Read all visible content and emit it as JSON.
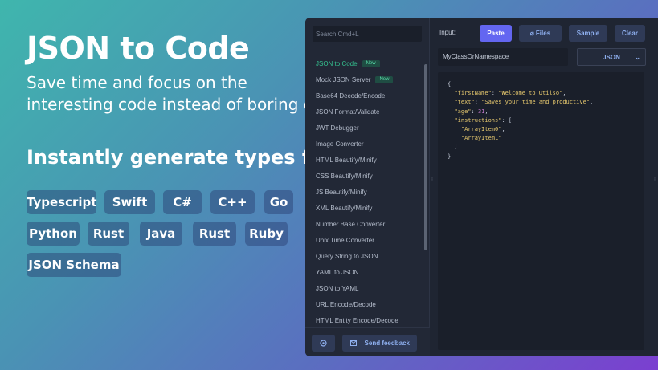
{
  "hero": {
    "title": "JSON to Code",
    "subtitle_line1": "Save time and focus on the",
    "subtitle_line2": "interesting code instead of boring one",
    "types_title": "Instantly generate types for",
    "languages": [
      "Typescript",
      "Swift",
      "C#",
      "C++",
      "Go",
      "Python",
      "Rust",
      "Java",
      "Rust",
      "Ruby",
      "JSON Schema"
    ]
  },
  "sidebar": {
    "search_placeholder": "Search Cmd+L",
    "items": [
      {
        "label": "JSON to Code",
        "badge": "New",
        "active": true
      },
      {
        "label": "Mock JSON Server",
        "badge": "New"
      },
      {
        "label": "Base64 Decode/Encode"
      },
      {
        "label": "JSON Format/Validate"
      },
      {
        "label": "JWT Debugger"
      },
      {
        "label": "Image Converter"
      },
      {
        "label": "HTML Beautify/Minify"
      },
      {
        "label": "CSS Beautify/Minify"
      },
      {
        "label": "JS Beautify/Minify"
      },
      {
        "label": "XML Beautify/Minify"
      },
      {
        "label": "Number Base Converter"
      },
      {
        "label": "Unix Time Converter"
      },
      {
        "label": "Query String to JSON"
      },
      {
        "label": "YAML to JSON"
      },
      {
        "label": "JSON to YAML"
      },
      {
        "label": "URL Encode/Decode"
      },
      {
        "label": "HTML Entity Encode/Decode"
      }
    ],
    "settings_icon": "gear-icon",
    "feedback_label": "Send feedback",
    "feedback_icon": "mail-icon"
  },
  "toolbar": {
    "input_label": "Input:",
    "paste_label": "Paste",
    "files_label": "Files",
    "files_icon": "paperclip-icon",
    "sample_label": "Sample",
    "clear_label": "Clear"
  },
  "editor": {
    "name_value": "MyClassOrNamespace",
    "language_value": "JSON",
    "lines": [
      "{",
      "  \"firstName\": \"Welcome to Utilso\",",
      "  \"text\": \"Saves your time and productive\",",
      "  \"age\": 31,",
      "  \"instructions\": [",
      "    \"ArrayItem0\",",
      "    \"ArrayItem1\"",
      "  ]",
      "}"
    ]
  },
  "colors": {
    "accent": "#6366f1",
    "active_item": "#34c08f"
  }
}
